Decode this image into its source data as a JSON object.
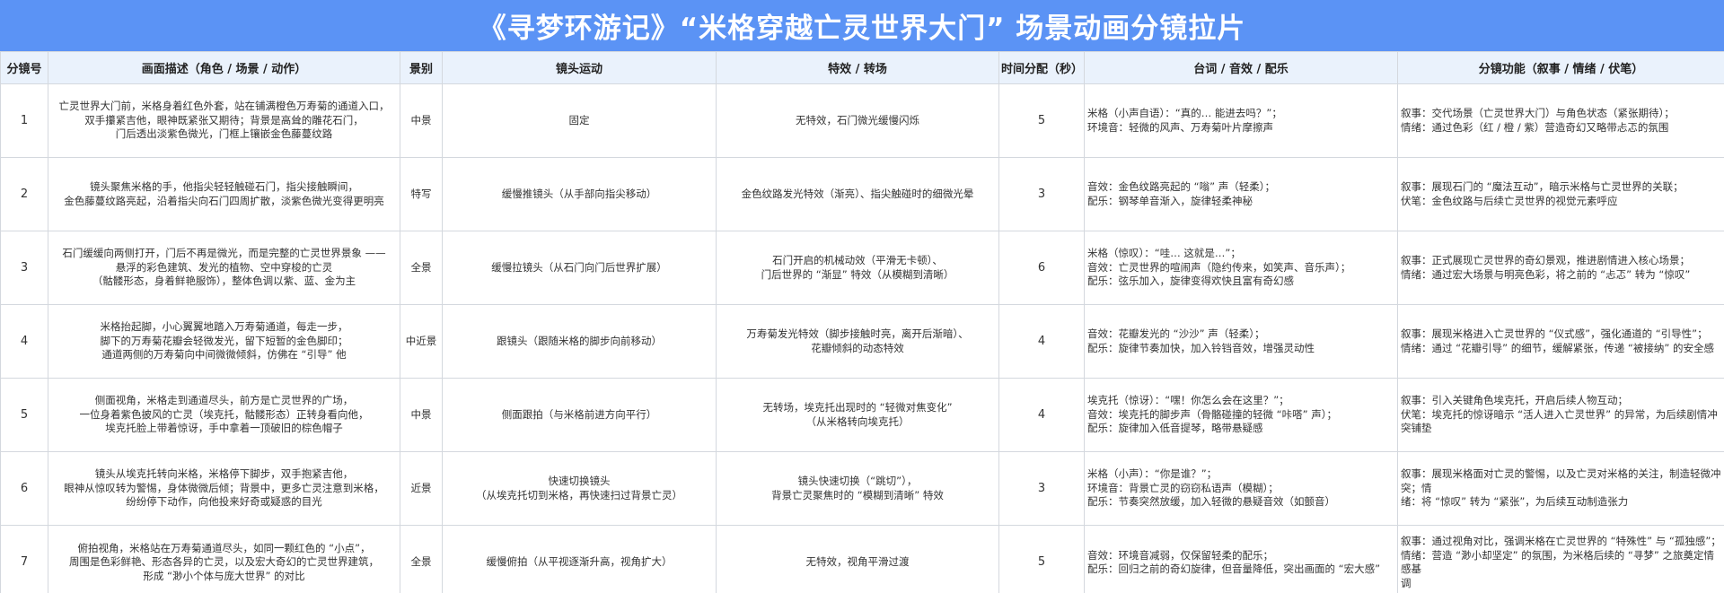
{
  "title": "《寻梦环游记》“米格穿越亡灵世界大门” 场景动画分镜拉片",
  "headers": [
    "分镜号",
    "画面描述（角色 / 场景 / 动作）",
    "景别",
    "镜头运动",
    "特效 / 转场",
    "时间分配（秒）",
    "台词 / 音效 / 配乐",
    "分镜功能（叙事 / 情绪 / 伏笔）"
  ],
  "rows": [
    {
      "no": "1",
      "desc": [
        "亡灵世界大门前，米格身着红色外套，站在铺满橙色万寿菊的通道入口，",
        "双手攥紧吉他，眼神既紧张又期待；背景是高耸的雕花石门，",
        "门后透出淡紫色微光，门框上镶嵌金色藤蔓纹路"
      ],
      "shot": "中景",
      "camera": [
        "固定"
      ],
      "fx": [
        "无特效，石门微光缓慢闪烁"
      ],
      "time": "5",
      "audio": [
        "米格（小声自语）：“真的… 能进去吗？”；",
        "环境音：轻微的风声、万寿菊叶片摩擦声"
      ],
      "func": [
        "叙事：交代场景（亡灵世界大门）与角色状态（紧张期待）；",
        "情绪：通过色彩（红 / 橙 / 紫）营造奇幻又略带忐忑的氛围"
      ]
    },
    {
      "no": "2",
      "desc": [
        "镜头聚焦米格的手，他指尖轻轻触碰石门，指尖接触瞬间，",
        "金色藤蔓纹路亮起，沿着指尖向石门四周扩散，淡紫色微光变得更明亮"
      ],
      "shot": "特写",
      "camera": [
        "缓慢推镜头（从手部向指尖移动）"
      ],
      "fx": [
        "金色纹路发光特效（渐亮）、指尖触碰时的细微光晕"
      ],
      "time": "3",
      "audio": [
        "音效：金色纹路亮起的 “嗡” 声（轻柔）；",
        "配乐：钢琴单音渐入，旋律轻柔神秘"
      ],
      "func": [
        "叙事：展现石门的 “魔法互动”，暗示米格与亡灵世界的关联；",
        "伏笔：金色纹路与后续亡灵世界的视觉元素呼应"
      ]
    },
    {
      "no": "3",
      "desc": [
        "石门缓缓向两侧打开，门后不再是微光，而是完整的亡灵世界景象 ——",
        "悬浮的彩色建筑、发光的植物、空中穿梭的亡灵",
        "（骷髅形态，身着鲜艳服饰），整体色调以紫、蓝、金为主"
      ],
      "shot": "全景",
      "camera": [
        "缓慢拉镜头（从石门向门后世界扩展）"
      ],
      "fx": [
        "石门开启的机械动效（平滑无卡顿）、",
        "门后世界的 “渐显” 特效（从模糊到清晰）"
      ],
      "time": "6",
      "audio": [
        "米格（惊叹）：“哇… 这就是…”；",
        "音效：亡灵世界的喧闹声（隐约传来，如笑声、音乐声）；",
        "配乐：弦乐加入，旋律变得欢快且富有奇幻感"
      ],
      "func": [
        "叙事：正式展现亡灵世界的奇幻景观，推进剧情进入核心场景；",
        "情绪：通过宏大场景与明亮色彩，将之前的 “忐忑” 转为 “惊叹”"
      ]
    },
    {
      "no": "4",
      "desc": [
        "米格抬起脚，小心翼翼地踏入万寿菊通道，每走一步，",
        "脚下的万寿菊花瓣会轻微发光，留下短暂的金色脚印；",
        "通道两侧的万寿菊向中间微微倾斜，仿佛在 “引导” 他"
      ],
      "shot": "中近景",
      "camera": [
        "跟镜头（跟随米格的脚步向前移动）"
      ],
      "fx": [
        "万寿菊发光特效（脚步接触时亮，离开后渐暗）、",
        "花瓣倾斜的动态特效"
      ],
      "time": "4",
      "audio": [
        "音效：花瓣发光的 “沙沙” 声（轻柔）；",
        "配乐：旋律节奏加快，加入铃铛音效，增强灵动性"
      ],
      "func": [
        "叙事：展现米格进入亡灵世界的 “仪式感”，强化通道的 “引导性”；",
        "情绪：通过 “花瓣引导” 的细节，缓解紧张，传递 “被接纳” 的安全感"
      ]
    },
    {
      "no": "5",
      "desc": [
        "侧面视角，米格走到通道尽头，前方是亡灵世界的广场，",
        "一位身着紫色披风的亡灵（埃克托，骷髅形态）正转身看向他，",
        "埃克托脸上带着惊讶，手中拿着一顶破旧的棕色帽子"
      ],
      "shot": "中景",
      "camera": [
        "侧面跟拍（与米格前进方向平行）"
      ],
      "fx": [
        "无转场，埃克托出现时的 “轻微对焦变化”",
        "（从米格转向埃克托）"
      ],
      "time": "4",
      "audio": [
        "埃克托（惊讶）：“嘿！你怎么会在这里？”；",
        "音效：埃克托的脚步声（骨骼碰撞的轻微 “咔嗒” 声）；",
        "配乐：旋律加入低音提琴，略带悬疑感"
      ],
      "func": [
        "叙事：引入关键角色埃克托，开启后续人物互动；",
        "伏笔：埃克托的惊讶暗示 “活人进入亡灵世界” 的异常，为后续剧情冲突铺垫"
      ]
    },
    {
      "no": "6",
      "desc": [
        "镜头从埃克托转向米格，米格停下脚步，双手抱紧吉他，",
        "眼神从惊叹转为警惕，身体微微后倾；背景中，更多亡灵注意到米格，",
        "纷纷停下动作，向他投来好奇或疑惑的目光"
      ],
      "shot": "近景",
      "camera": [
        "快速切换镜头",
        "（从埃克托切到米格，再快速扫过背景亡灵）"
      ],
      "fx": [
        "镜头快速切换（“跳切”），",
        "背景亡灵聚焦时的 “模糊到清晰” 特效"
      ],
      "time": "3",
      "audio": [
        "米格（小声）：“你是谁？”；",
        "环境音：背景亡灵的窃窃私语声（模糊）；",
        "配乐：节奏突然放缓，加入轻微的悬疑音效（如颤音）"
      ],
      "func": [
        "叙事：展现米格面对亡灵的警惕，以及亡灵对米格的关注，制造轻微冲突；情",
        "绪：将 “惊叹” 转为 “紧张”，为后续互动制造张力"
      ]
    },
    {
      "no": "7",
      "desc": [
        "俯拍视角，米格站在万寿菊通道尽头，如同一颗红色的 “小点”，",
        "周围是色彩鲜艳、形态各异的亡灵，以及宏大奇幻的亡灵世界建筑，",
        "形成 “渺小个体与庞大世界” 的对比"
      ],
      "shot": "全景",
      "camera": [
        "缓慢俯拍（从平视逐渐升高，视角扩大）"
      ],
      "fx": [
        "无特效，视角平滑过渡"
      ],
      "time": "5",
      "audio": [
        "音效：环境音减弱，仅保留轻柔的配乐；",
        "配乐：回归之前的奇幻旋律，但音量降低，突出画面的 “宏大感”"
      ],
      "func": [
        "叙事：通过视角对比，强调米格在亡灵世界的 “特殊性” 与 “孤独感”；",
        "情绪：营造 “渺小却坚定” 的氛围，为米格后续的 “寻梦” 之旅奠定情感基",
        "调"
      ]
    }
  ]
}
